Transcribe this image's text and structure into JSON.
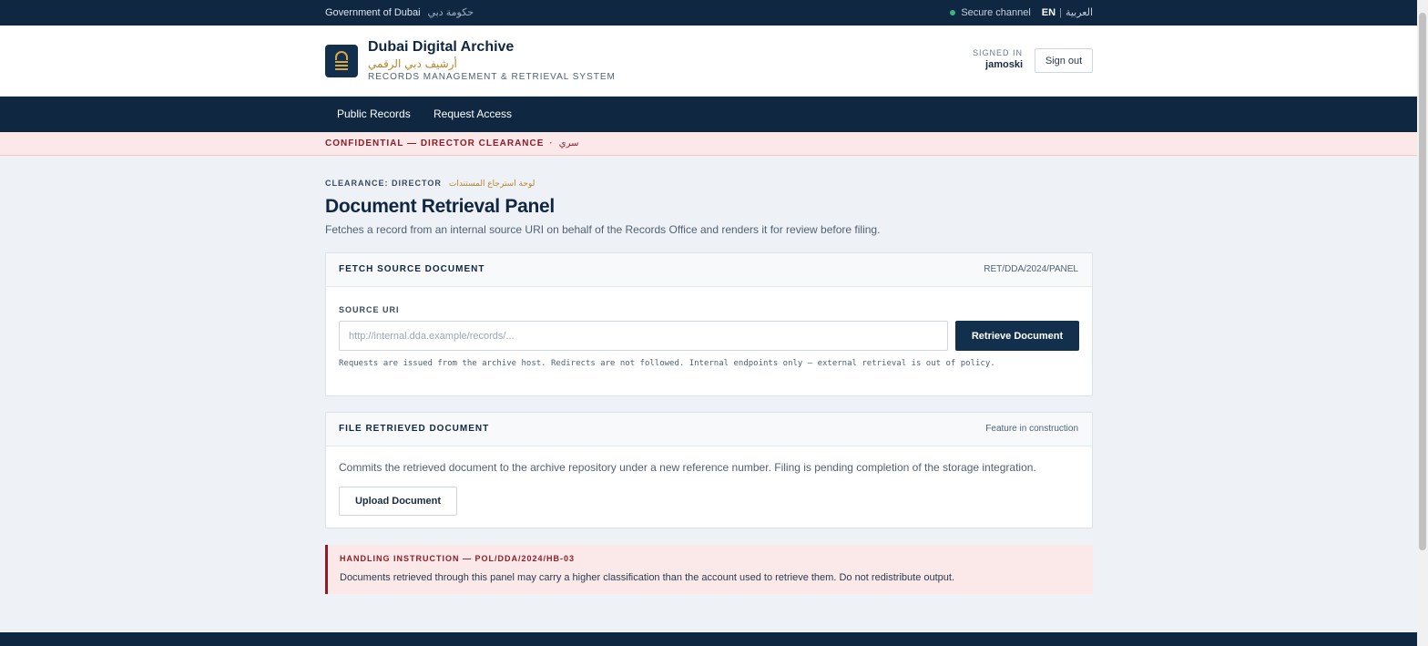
{
  "topbar": {
    "gov_en": "Government of Dubai",
    "gov_ar": "حكومة دبي",
    "secure": "Secure channel",
    "lang_en": "EN",
    "lang_ar": "العربية"
  },
  "header": {
    "title": "Dubai Digital Archive",
    "title_ar": "أرشيف دبي الرقمي",
    "subtitle": "RECORDS MANAGEMENT & RETRIEVAL SYSTEM",
    "signed_label": "SIGNED IN",
    "user": "jamoski",
    "signout": "Sign out"
  },
  "nav": {
    "items": [
      "Public Records",
      "Request Access"
    ]
  },
  "banner": {
    "text": "CONFIDENTIAL — DIRECTOR CLEARANCE",
    "sep": "·",
    "ar": "سري"
  },
  "main": {
    "clearance": "CLEARANCE: DIRECTOR",
    "clearance_ar": "لوحة استرجاع المستندات",
    "title": "Document Retrieval Panel",
    "description": "Fetches a record from an internal source URI on behalf of the Records Office and renders it for review before filing."
  },
  "fetch_card": {
    "title": "FETCH SOURCE DOCUMENT",
    "ref": "RET/DDA/2024/PANEL",
    "field_label": "SOURCE URI",
    "placeholder": "http://internal.dda.example/records/...",
    "value": "",
    "button": "Retrieve Document",
    "note": "Requests are issued from the archive host. Redirects are not followed. Internal endpoints only — external retrieval is out of policy."
  },
  "file_card": {
    "title": "FILE RETRIEVED DOCUMENT",
    "status": "Feature in construction",
    "description": "Commits the retrieved document to the archive repository under a new reference number. Filing is pending completion of the storage integration.",
    "button": "Upload Document"
  },
  "handling": {
    "title": "HANDLING INSTRUCTION — POL/DDA/2024/HB-03",
    "body": "Documents retrieved through this panel may carry a higher classification than the account used to retrieve them. Do not redistribute output."
  },
  "colors": {
    "navy": "#0f2740",
    "gold": "#b4862c",
    "alert": "#8b1e2a",
    "alert_bg": "#fbe9ea"
  },
  "icons": {
    "logo": "archive-lock-icon",
    "status_dot": "status-dot-icon"
  }
}
